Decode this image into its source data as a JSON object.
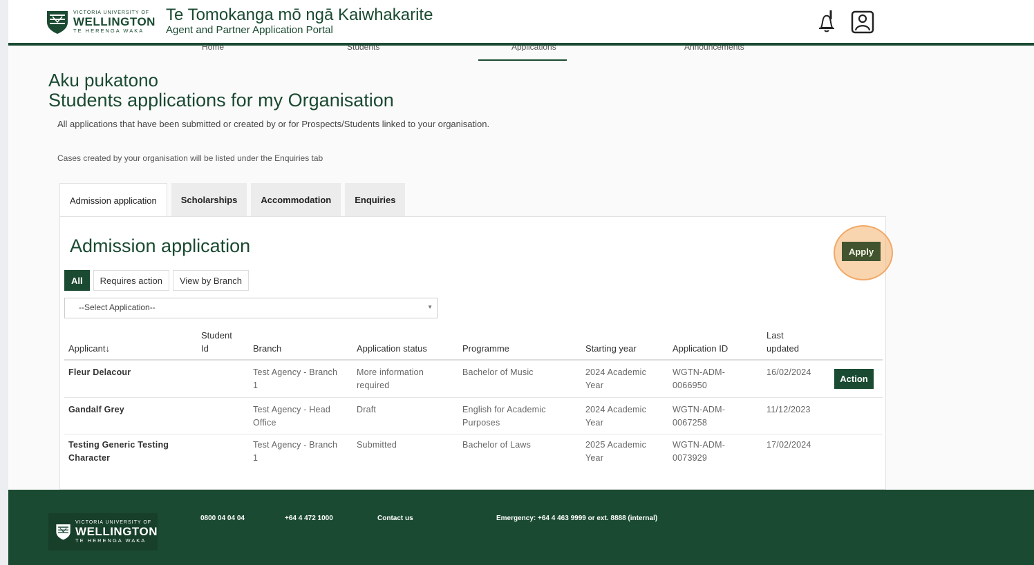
{
  "header": {
    "logo_small": "VICTORIA UNIVERSITY OF",
    "logo_big": "WELLINGTON",
    "logo_sub": "TE HERENGA WAKA",
    "portal_title": "Te Tomokanga mō ngā Kaiwhakarite",
    "portal_sub": "Agent and Partner Application Portal",
    "bell_icon": "bell-icon",
    "user_icon": "user-icon"
  },
  "nav": {
    "items": [
      "Home",
      "Students",
      "Applications",
      "Announcements"
    ],
    "active": "Applications"
  },
  "page": {
    "greeting": "Aku pukatono",
    "title": "Students applications for my Organisation",
    "description": "All applications that have been submitted or created by or for Prospects/Students linked to your organisation.",
    "note": "Cases created by your organisation will be listed under the Enquiries tab"
  },
  "tabs": [
    {
      "label": "Admission application",
      "active": true
    },
    {
      "label": "Scholarships",
      "active": false
    },
    {
      "label": "Accommodation",
      "active": false
    },
    {
      "label": "Enquiries",
      "active": false
    }
  ],
  "panel": {
    "title": "Admission application",
    "apply_label": "Apply",
    "filters": [
      "All",
      "Requires action",
      "View by Branch"
    ],
    "select_placeholder": "--Select Application--"
  },
  "table": {
    "headers": {
      "applicant": "Applicant",
      "student_id_1": "Student",
      "student_id_2": "Id",
      "branch": "Branch",
      "status": "Application status",
      "programme": "Programme",
      "starting_year": "Starting year",
      "application_id": "Application ID",
      "last_updated_1": "Last",
      "last_updated_2": "updated"
    },
    "sort_indicator": "↓",
    "rows": [
      {
        "applicant_1": "Fleur Delacour",
        "applicant_2": "",
        "branch_1": "Test Agency - Branch",
        "branch_2": "1",
        "status_1": "More information",
        "status_2": "required",
        "programme_1": "Bachelor of Music",
        "programme_2": "",
        "year_1": "2024 Academic",
        "year_2": "Year",
        "id_1": "WGTN-ADM-",
        "id_2": "0066950",
        "updated": "16/02/2024",
        "action": "Action"
      },
      {
        "applicant_1": "Gandalf Grey",
        "applicant_2": "",
        "branch_1": "Test Agency - Head",
        "branch_2": "Office",
        "status_1": "Draft",
        "status_2": "",
        "programme_1": "English for Academic",
        "programme_2": "Purposes",
        "year_1": "2024 Academic",
        "year_2": "Year",
        "id_1": "WGTN-ADM-",
        "id_2": "0067258",
        "updated": "11/12/2023",
        "action": ""
      },
      {
        "applicant_1": "Testing Generic Testing",
        "applicant_2": "Character",
        "branch_1": "Test Agency - Branch",
        "branch_2": "1",
        "status_1": "Submitted",
        "status_2": "",
        "programme_1": "Bachelor of Laws",
        "programme_2": "",
        "year_1": "2025 Academic",
        "year_2": "Year",
        "id_1": "WGTN-ADM-",
        "id_2": "0073929",
        "updated": "17/02/2024",
        "action": ""
      }
    ]
  },
  "footer": {
    "logo_small": "VICTORIA UNIVERSITY OF",
    "logo_big": "WELLINGTON",
    "logo_sub": "TE HERENGA WAKA",
    "phone_1": "0800 04 04 04",
    "phone_2": "+64 4 472 1000",
    "contact": "Contact us",
    "emergency": "Emergency: +64 4 463 9999 or ext. 8888 (internal)"
  },
  "colors": {
    "brand_green": "#1a4a31",
    "apply_olive": "#41542f",
    "highlight": "#f1a866"
  }
}
